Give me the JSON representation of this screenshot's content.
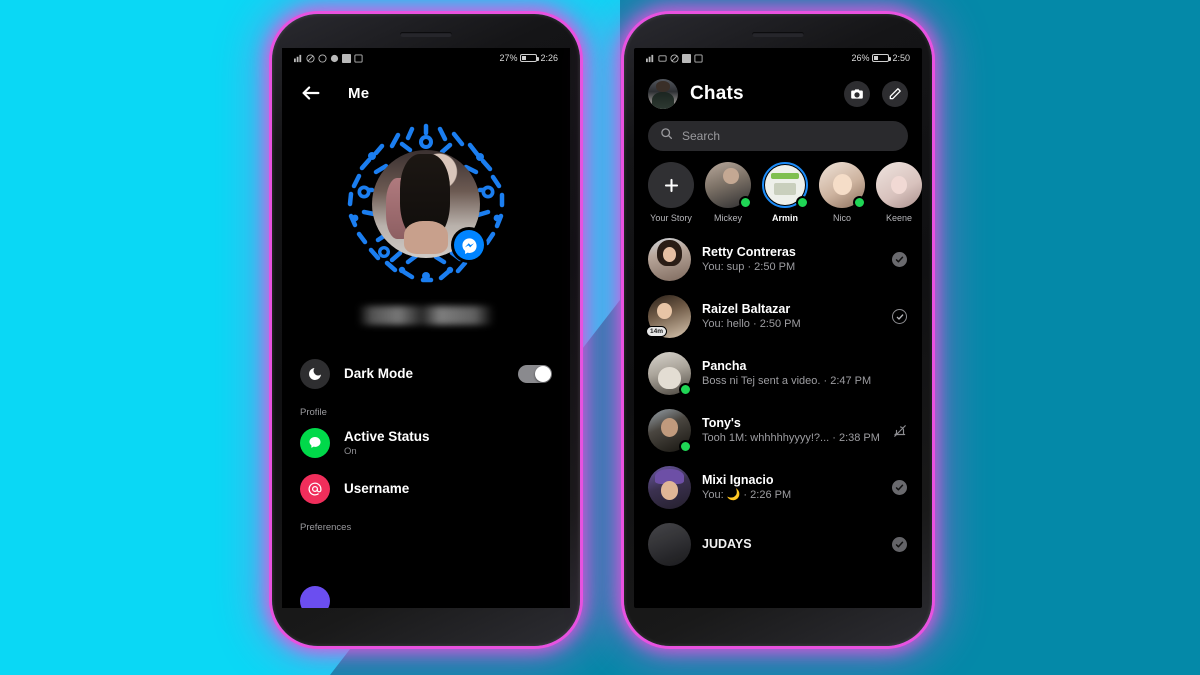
{
  "background": {
    "primary_color": "#0ad8f5",
    "secondary_color": "#0489a8",
    "phone_glow_color": "#e852e0"
  },
  "left_phone": {
    "status_bar": {
      "battery_percent": "27%",
      "time": "2:26",
      "icons": [
        "signal-icon",
        "mute-icon",
        "whatsapp-icon",
        "record-icon",
        "facebook-icon",
        "gallery-icon"
      ]
    },
    "header": {
      "back_label": "back-arrow",
      "title": "Me"
    },
    "profile": {
      "qr_code_label": "messenger-qr-code",
      "name_hidden": true
    },
    "dark_mode_row": {
      "label": "Dark Mode",
      "icon": "moon-icon",
      "toggle_on": true
    },
    "sections": [
      {
        "label": "Profile",
        "items": [
          {
            "label": "Active Status",
            "sub": "On",
            "icon": "active-status-icon",
            "icon_color": "#00d94a"
          },
          {
            "label": "Username",
            "sub": "",
            "icon": "at-icon",
            "icon_color": "#f02e5b",
            "sub_hidden": true
          }
        ]
      },
      {
        "label": "Preferences",
        "items": []
      }
    ]
  },
  "right_phone": {
    "status_bar": {
      "battery_percent": "26%",
      "time": "2:50",
      "icons": [
        "signal-icon",
        "alarm-icon",
        "mute-icon",
        "facebook-icon",
        "gallery-icon"
      ]
    },
    "header": {
      "title": "Chats",
      "avatar": "profile-avatar",
      "camera_button": "camera-icon",
      "compose_button": "compose-icon"
    },
    "search": {
      "placeholder": "Search",
      "icon": "search-icon"
    },
    "stories": [
      {
        "name": "Your Story",
        "type": "add",
        "online": false,
        "active": false
      },
      {
        "name": "Mickey",
        "type": "photo",
        "photo": "p-mickey",
        "online": true,
        "active": false
      },
      {
        "name": "Armin",
        "type": "photo",
        "photo": "p-armin",
        "online": true,
        "active": true
      },
      {
        "name": "Nico",
        "type": "photo",
        "photo": "p-nico",
        "online": true,
        "active": false
      },
      {
        "name": "Keene",
        "type": "photo",
        "photo": "p-keene",
        "online": false,
        "active": false
      }
    ],
    "chats": [
      {
        "name": "Retty Contreras",
        "snippet": "You: sup · 2:50 PM",
        "photo": "p-retty",
        "status": "seen-filled",
        "online": false,
        "badge": ""
      },
      {
        "name": "Raizel Baltazar",
        "snippet": "You: hello · 2:50 PM",
        "photo": "p-raizel",
        "status": "delivered-open",
        "online": false,
        "badge": "14m"
      },
      {
        "name": "Pancha",
        "snippet": "Boss ni Tej sent a video. · 2:47 PM",
        "photo": "p-pancha",
        "status": "none",
        "online": true,
        "badge": ""
      },
      {
        "name": "Tony's",
        "snippet": "Tooh 1M: whhhhhyyyy!?... · 2:38 PM",
        "photo": "p-tony",
        "status": "muted",
        "online": true,
        "badge": ""
      },
      {
        "name": "Mixi Ignacio",
        "snippet": "You: 🌙 · 2:26 PM",
        "photo": "p-mixi",
        "status": "seen-filled",
        "online": false,
        "badge": ""
      },
      {
        "name": "JUDAYS",
        "snippet": "",
        "photo": "p-judays",
        "status": "seen-filled",
        "online": false,
        "badge": ""
      }
    ]
  }
}
